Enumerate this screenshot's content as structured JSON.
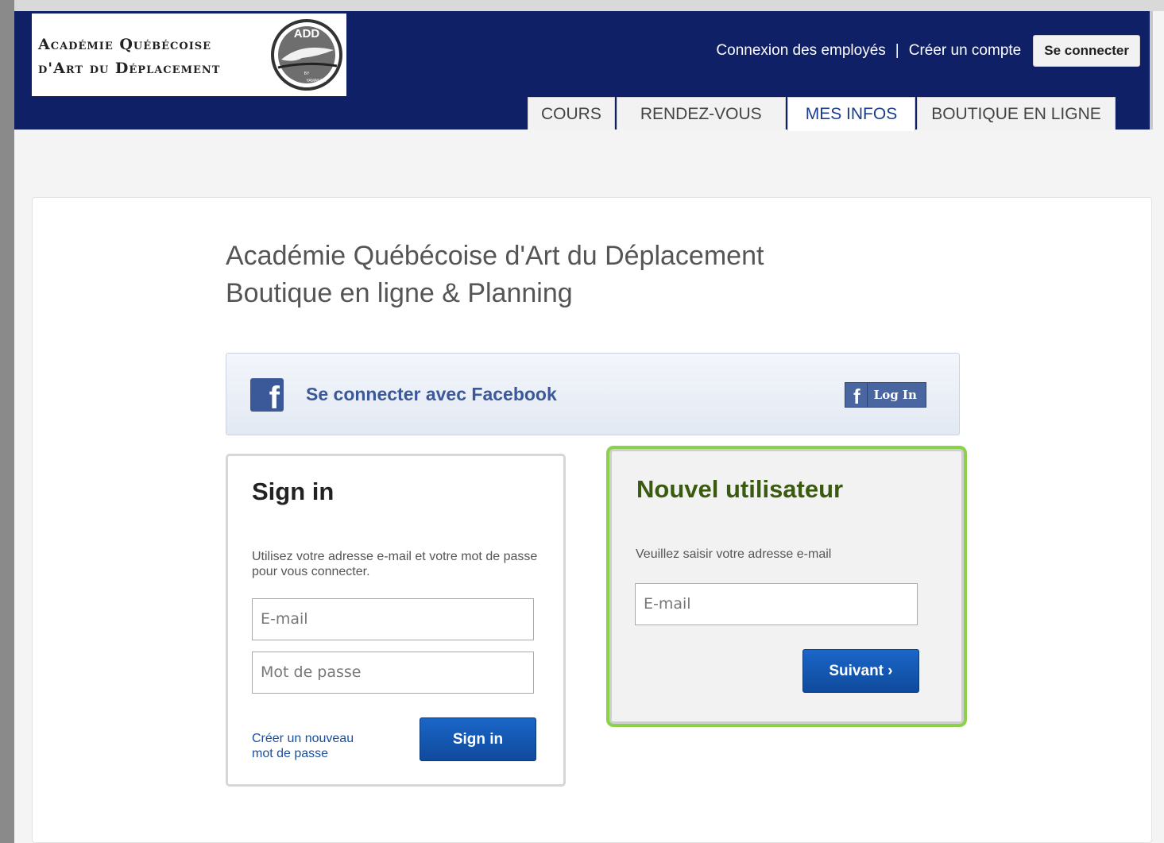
{
  "header": {
    "logo_line1": "Académie Québécoise",
    "logo_line2": "d'Art du Déplacement",
    "seal_text_top": "ADD",
    "seal_text_by": "BY",
    "seal_text_bottom": "YAMAKASI",
    "employee_login": "Connexion des employés",
    "separator": "|",
    "create_account": "Créer un compte",
    "connect_button": "Se connecter"
  },
  "tabs": [
    {
      "label": "COURS",
      "active": false
    },
    {
      "label": "RENDEZ-VOUS",
      "active": false
    },
    {
      "label": "MES INFOS",
      "active": true
    },
    {
      "label": "BOUTIQUE EN LIGNE",
      "active": false
    }
  ],
  "main": {
    "title_line1": "Académie Québécoise d'Art du Déplacement",
    "title_line2": "Boutique en ligne & Planning"
  },
  "facebook": {
    "icon_letter": "f",
    "text": "Se connecter avec Facebook",
    "login_icon": "f",
    "login_label": "Log In"
  },
  "signin": {
    "title": "Sign in",
    "description": "Utilisez votre adresse e-mail et votre mot de passe pour vous connecter.",
    "email_placeholder": "E-mail",
    "password_placeholder": "Mot de passe",
    "reset_link_line1": "Créer un nouveau",
    "reset_link_line2": "mot de passe",
    "button": "Sign in"
  },
  "new_user": {
    "title": "Nouvel utilisateur",
    "description": "Veuillez saisir votre adresse e-mail",
    "email_placeholder": "E-mail",
    "button": "Suivant ›"
  },
  "colors": {
    "header_bg": "#0f2066",
    "facebook_blue": "#3b5998",
    "button_blue": "#1a66c8",
    "highlight_green": "#8bd14a",
    "new_user_title": "#3a5a10"
  }
}
